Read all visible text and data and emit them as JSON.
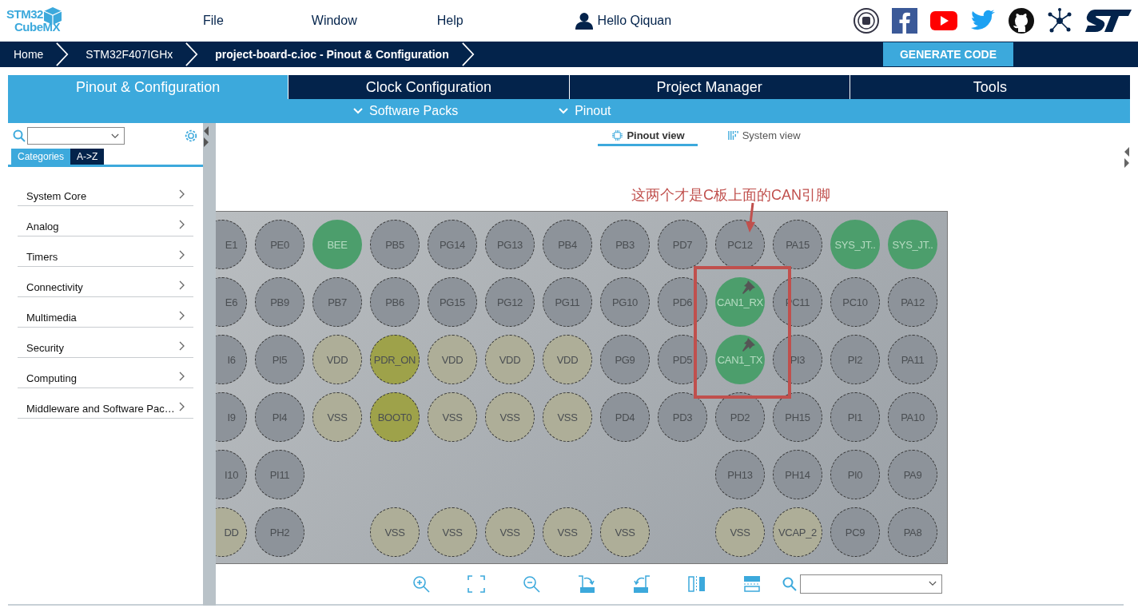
{
  "logo": {
    "line1": "STM32",
    "line2": "CubeMX"
  },
  "menu": [
    "File",
    "Window",
    "Help"
  ],
  "user": {
    "greeting": "Hello Qiquan"
  },
  "breadcrumb": [
    {
      "label": "Home",
      "current": false
    },
    {
      "label": "STM32F407IGHx",
      "current": false
    },
    {
      "label": "project-board-c.ioc - Pinout & Configuration",
      "current": true
    }
  ],
  "generate_button": "GENERATE CODE",
  "tabs": [
    {
      "label": "Pinout & Configuration",
      "selected": true
    },
    {
      "label": "Clock Configuration",
      "selected": false
    },
    {
      "label": "Project Manager",
      "selected": false
    },
    {
      "label": "Tools",
      "selected": false
    }
  ],
  "subtabs": [
    "Software Packs",
    "Pinout"
  ],
  "sidebar": {
    "modes": [
      {
        "label": "Categories",
        "selected": true
      },
      {
        "label": "A->Z",
        "selected": false
      }
    ],
    "items": [
      "System Core",
      "Analog",
      "Timers",
      "Connectivity",
      "Multimedia",
      "Security",
      "Computing",
      "Middleware and Software Pac…"
    ]
  },
  "views": [
    {
      "label": "Pinout view",
      "selected": true
    },
    {
      "label": "System view",
      "selected": false
    }
  ],
  "pinout": {
    "annotation": "这两个才是C板上面的CAN引脚",
    "rows": [
      [
        {
          "label": "E1",
          "kind": "io",
          "pinned": false
        },
        {
          "label": "PE0",
          "kind": "io",
          "pinned": false
        },
        {
          "label": "BEE",
          "kind": "assigned",
          "pinned": false
        },
        {
          "label": "PB5",
          "kind": "io",
          "pinned": false
        },
        {
          "label": "PG14",
          "kind": "io",
          "pinned": false
        },
        {
          "label": "PG13",
          "kind": "io",
          "pinned": false
        },
        {
          "label": "PB4",
          "kind": "io",
          "pinned": false
        },
        {
          "label": "PB3",
          "kind": "io",
          "pinned": false
        },
        {
          "label": "PD7",
          "kind": "io",
          "pinned": false
        },
        {
          "label": "PC12",
          "kind": "io",
          "pinned": false
        },
        {
          "label": "PA15",
          "kind": "io",
          "pinned": false
        },
        {
          "label": "SYS_JT..",
          "kind": "assigned",
          "pinned": false
        },
        {
          "label": "SYS_JT..",
          "kind": "assigned",
          "pinned": false
        }
      ],
      [
        {
          "label": "E6",
          "kind": "io",
          "pinned": false
        },
        {
          "label": "PB9",
          "kind": "io",
          "pinned": false
        },
        {
          "label": "PB7",
          "kind": "io",
          "pinned": false
        },
        {
          "label": "PB6",
          "kind": "io",
          "pinned": false
        },
        {
          "label": "PG15",
          "kind": "io",
          "pinned": false
        },
        {
          "label": "PG12",
          "kind": "io",
          "pinned": false
        },
        {
          "label": "PG11",
          "kind": "io",
          "pinned": false
        },
        {
          "label": "PG10",
          "kind": "io",
          "pinned": false
        },
        {
          "label": "PD6",
          "kind": "io",
          "pinned": false
        },
        {
          "label": "CAN1_RX",
          "kind": "assigned",
          "pinned": true
        },
        {
          "label": "PC11",
          "kind": "io",
          "pinned": false
        },
        {
          "label": "PC10",
          "kind": "io",
          "pinned": false
        },
        {
          "label": "PA12",
          "kind": "io",
          "pinned": false
        }
      ],
      [
        {
          "label": "I6",
          "kind": "io",
          "pinned": false
        },
        {
          "label": "PI5",
          "kind": "io",
          "pinned": false
        },
        {
          "label": "VDD",
          "kind": "power",
          "pinned": false
        },
        {
          "label": "PDR_ON",
          "kind": "boot",
          "pinned": false
        },
        {
          "label": "VDD",
          "kind": "power",
          "pinned": false
        },
        {
          "label": "VDD",
          "kind": "power",
          "pinned": false
        },
        {
          "label": "VDD",
          "kind": "power",
          "pinned": false
        },
        {
          "label": "PG9",
          "kind": "io",
          "pinned": false
        },
        {
          "label": "PD5",
          "kind": "io",
          "pinned": false
        },
        {
          "label": "CAN1_TX",
          "kind": "assigned",
          "pinned": true
        },
        {
          "label": "PI3",
          "kind": "io",
          "pinned": false
        },
        {
          "label": "PI2",
          "kind": "io",
          "pinned": false
        },
        {
          "label": "PA11",
          "kind": "io",
          "pinned": false
        }
      ],
      [
        {
          "label": "I9",
          "kind": "io",
          "pinned": false
        },
        {
          "label": "PI4",
          "kind": "io",
          "pinned": false
        },
        {
          "label": "VSS",
          "kind": "power",
          "pinned": false
        },
        {
          "label": "BOOT0",
          "kind": "boot",
          "pinned": false
        },
        {
          "label": "VSS",
          "kind": "power",
          "pinned": false
        },
        {
          "label": "VSS",
          "kind": "power",
          "pinned": false
        },
        {
          "label": "VSS",
          "kind": "power",
          "pinned": false
        },
        {
          "label": "PD4",
          "kind": "io",
          "pinned": false
        },
        {
          "label": "PD3",
          "kind": "io",
          "pinned": false
        },
        {
          "label": "PD2",
          "kind": "io",
          "pinned": false
        },
        {
          "label": "PH15",
          "kind": "io",
          "pinned": false
        },
        {
          "label": "PI1",
          "kind": "io",
          "pinned": false
        },
        {
          "label": "PA10",
          "kind": "io",
          "pinned": false
        }
      ],
      [
        {
          "label": "I10",
          "kind": "io",
          "pinned": false
        },
        {
          "label": "PI11",
          "kind": "io",
          "pinned": false
        },
        {
          "kind": "empty"
        },
        {
          "kind": "empty"
        },
        {
          "kind": "empty"
        },
        {
          "kind": "empty"
        },
        {
          "kind": "empty"
        },
        {
          "kind": "empty"
        },
        {
          "kind": "empty"
        },
        {
          "label": "PH13",
          "kind": "io",
          "pinned": false
        },
        {
          "label": "PH14",
          "kind": "io",
          "pinned": false
        },
        {
          "label": "PI0",
          "kind": "io",
          "pinned": false
        },
        {
          "label": "PA9",
          "kind": "io",
          "pinned": false
        }
      ],
      [
        {
          "label": "DD",
          "kind": "power",
          "pinned": false
        },
        {
          "label": "PH2",
          "kind": "io",
          "pinned": false
        },
        {
          "kind": "empty"
        },
        {
          "label": "VSS",
          "kind": "power",
          "pinned": false
        },
        {
          "label": "VSS",
          "kind": "power",
          "pinned": false
        },
        {
          "label": "VSS",
          "kind": "power",
          "pinned": false
        },
        {
          "label": "VSS",
          "kind": "power",
          "pinned": false
        },
        {
          "label": "VSS",
          "kind": "power",
          "pinned": false
        },
        {
          "kind": "empty"
        },
        {
          "label": "VSS",
          "kind": "power",
          "pinned": false
        },
        {
          "label": "VCAP_2",
          "kind": "power",
          "pinned": false
        },
        {
          "label": "PC9",
          "kind": "io",
          "pinned": false
        },
        {
          "label": "PA8",
          "kind": "io",
          "pinned": false
        }
      ]
    ]
  }
}
